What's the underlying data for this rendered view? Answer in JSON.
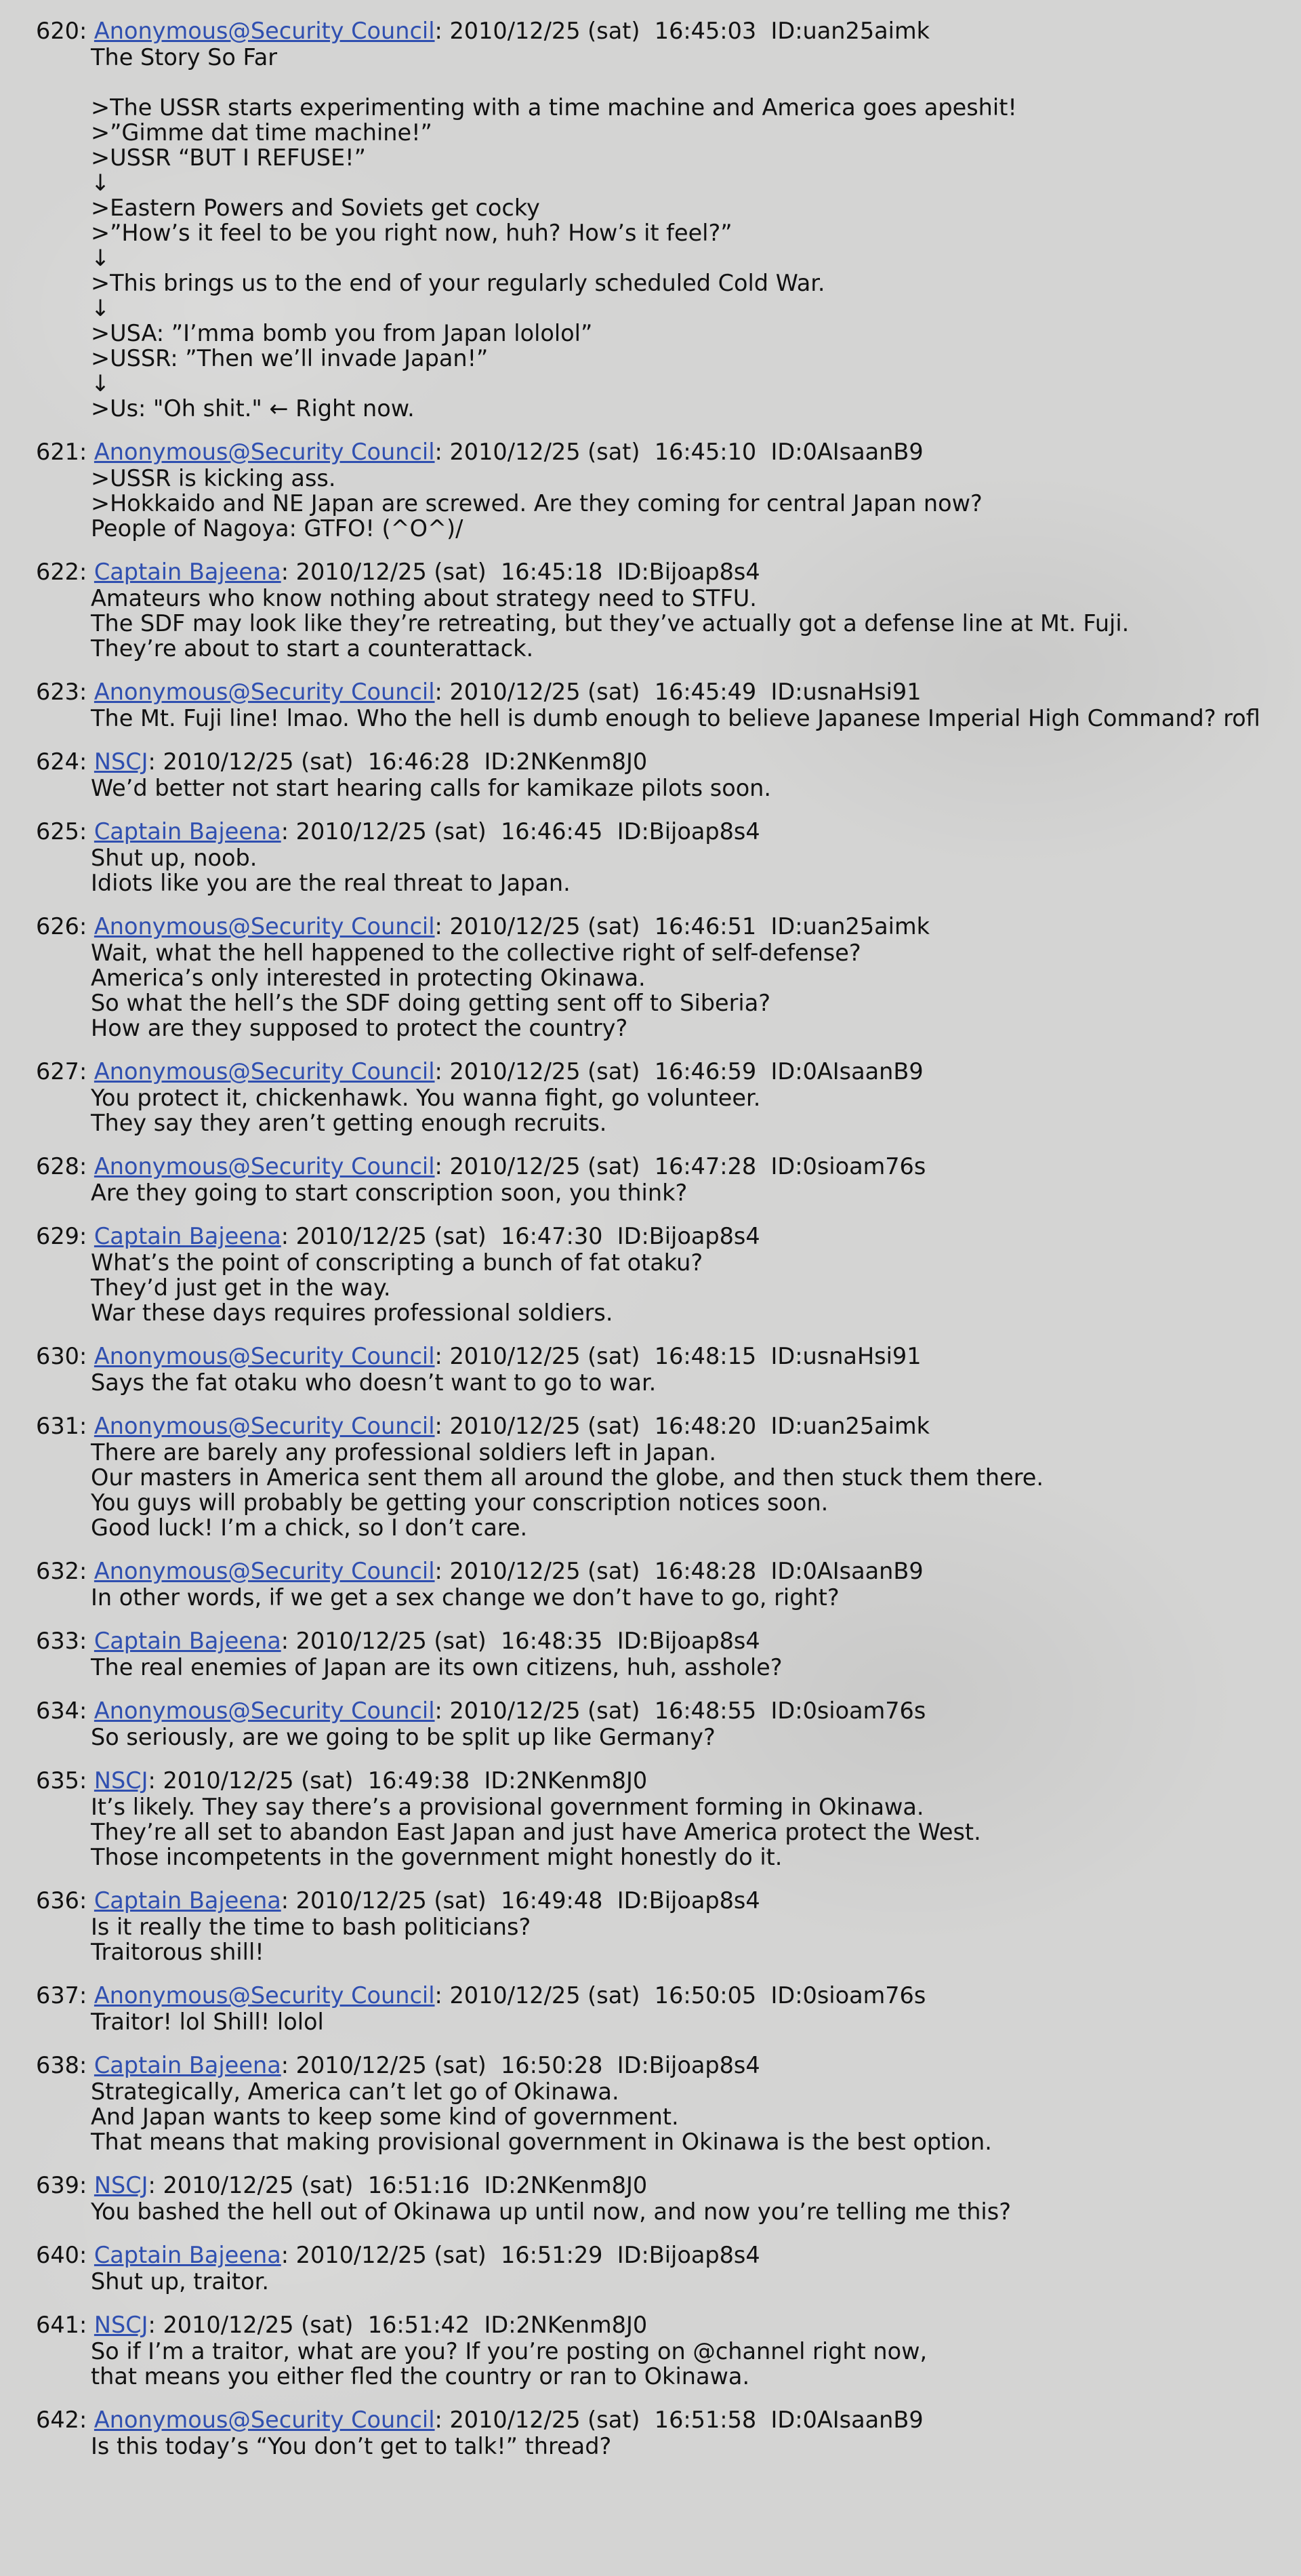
{
  "thread": {
    "posts": [
      {
        "number": "620",
        "name": "Anonymous@Security Council",
        "date": "2010/12/25 (sat)",
        "time": "16:45:03",
        "id": "ID:uan25aimk",
        "lines": [
          "The Story So Far",
          "",
          ">The USSR starts experimenting with a time machine and America goes apeshit!",
          ">”Gimme dat time machine!”",
          ">USSR “BUT I REFUSE!”",
          "↓",
          ">Eastern Powers and Soviets get cocky",
          ">”How’s it feel to be you right now, huh? How’s it feel?”",
          "↓",
          ">This brings us to the end of your regularly scheduled Cold War.",
          "↓",
          ">USA: ”I’mma bomb you from Japan lololol”",
          ">USSR: ”Then we’ll invade Japan!”",
          "↓",
          ">Us: \"Oh shit.\" ← Right now."
        ]
      },
      {
        "number": "621",
        "name": "Anonymous@Security Council",
        "date": "2010/12/25 (sat)",
        "time": "16:45:10",
        "id": "ID:0AIsaanB9",
        "lines": [
          ">USSR is kicking ass.",
          ">Hokkaido and NE Japan are screwed. Are they coming for central Japan now?",
          "People of Nagoya: GTFO! (^O^)/"
        ]
      },
      {
        "number": "622",
        "name": "Captain Bajeena",
        "date": "2010/12/25 (sat)",
        "time": "16:45:18",
        "id": "ID:Bijoap8s4",
        "lines": [
          "Amateurs who know nothing about strategy need to STFU.",
          "The SDF may look like they’re retreating, but they’ve actually got a defense line at Mt. Fuji.",
          "They’re about to start a counterattack."
        ]
      },
      {
        "number": "623",
        "name": "Anonymous@Security Council",
        "date": "2010/12/25 (sat)",
        "time": "16:45:49",
        "id": "ID:usnaHsi91",
        "lines": [
          "The Mt. Fuji line! lmao. Who the hell is dumb enough to believe Japanese Imperial High Command? rofl"
        ]
      },
      {
        "number": "624",
        "name": "NSCJ",
        "date": "2010/12/25 (sat)",
        "time": "16:46:28",
        "id": "ID:2NKenm8J0",
        "lines": [
          "We’d better not start hearing calls for kamikaze pilots soon."
        ]
      },
      {
        "number": "625",
        "name": "Captain Bajeena",
        "date": "2010/12/25 (sat)",
        "time": "16:46:45",
        "id": "ID:Bijoap8s4",
        "lines": [
          "Shut up, noob.",
          "Idiots like you are the real threat to Japan."
        ]
      },
      {
        "number": "626",
        "name": "Anonymous@Security Council",
        "date": "2010/12/25 (sat)",
        "time": "16:46:51",
        "id": "ID:uan25aimk",
        "lines": [
          "Wait, what the hell happened to the collective right of self-defense?",
          "America’s only interested in protecting Okinawa.",
          "So what the hell’s the SDF doing getting sent off to Siberia?",
          "How are they supposed to protect the country?"
        ]
      },
      {
        "number": "627",
        "name": "Anonymous@Security Council",
        "date": "2010/12/25 (sat)",
        "time": "16:46:59",
        "id": "ID:0AIsaanB9",
        "lines": [
          "You protect it, chickenhawk. You wanna fight, go volunteer.",
          "They say they aren’t getting enough recruits."
        ]
      },
      {
        "number": "628",
        "name": "Anonymous@Security Council",
        "date": "2010/12/25 (sat)",
        "time": "16:47:28",
        "id": "ID:0sioam76s",
        "lines": [
          "Are they going to start conscription soon, you think?"
        ]
      },
      {
        "number": "629",
        "name": "Captain Bajeena",
        "date": "2010/12/25 (sat)",
        "time": "16:47:30",
        "id": "ID:Bijoap8s4",
        "lines": [
          "What’s the point of conscripting a bunch of fat otaku?",
          "They’d just get in the way.",
          "War these days requires professional soldiers."
        ]
      },
      {
        "number": "630",
        "name": "Anonymous@Security Council",
        "date": "2010/12/25 (sat)",
        "time": "16:48:15",
        "id": "ID:usnaHsi91",
        "lines": [
          "Says the fat otaku who doesn’t want to go to war."
        ]
      },
      {
        "number": "631",
        "name": "Anonymous@Security Council",
        "date": "2010/12/25 (sat)",
        "time": "16:48:20",
        "id": "ID:uan25aimk",
        "lines": [
          "There are barely any professional soldiers left in Japan.",
          "Our masters in America sent them all around the globe, and then stuck them there.",
          "You guys will probably be getting your conscription notices soon.",
          "Good luck! I’m a chick, so I don’t care."
        ]
      },
      {
        "number": "632",
        "name": "Anonymous@Security Council",
        "date": "2010/12/25 (sat)",
        "time": "16:48:28",
        "id": "ID:0AIsaanB9",
        "lines": [
          "In other words, if we get a sex change we don’t have to go, right?"
        ]
      },
      {
        "number": "633",
        "name": "Captain Bajeena",
        "date": "2010/12/25 (sat)",
        "time": "16:48:35",
        "id": "ID:Bijoap8s4",
        "lines": [
          "The real enemies of Japan are its own citizens, huh, asshole?"
        ]
      },
      {
        "number": "634",
        "name": "Anonymous@Security Council",
        "date": "2010/12/25 (sat)",
        "time": "16:48:55",
        "id": "ID:0sioam76s",
        "lines": [
          "So seriously, are we going to be split up like Germany?"
        ]
      },
      {
        "number": "635",
        "name": "NSCJ",
        "date": "2010/12/25 (sat)",
        "time": "16:49:38",
        "id": "ID:2NKenm8J0",
        "lines": [
          "It’s likely. They say there’s a provisional government forming in Okinawa.",
          "They’re all set to abandon East Japan and just have America protect the West.",
          "Those incompetents in the government might honestly do it."
        ]
      },
      {
        "number": "636",
        "name": "Captain Bajeena",
        "date": "2010/12/25 (sat)",
        "time": "16:49:48",
        "id": "ID:Bijoap8s4",
        "lines": [
          "Is it really the time to bash politicians?",
          "Traitorous shill!"
        ]
      },
      {
        "number": "637",
        "name": "Anonymous@Security Council",
        "date": "2010/12/25 (sat)",
        "time": "16:50:05",
        "id": "ID:0sioam76s",
        "lines": [
          "Traitor! lol Shill! lolol"
        ]
      },
      {
        "number": "638",
        "name": "Captain Bajeena",
        "date": "2010/12/25 (sat)",
        "time": "16:50:28",
        "id": "ID:Bijoap8s4",
        "lines": [
          "Strategically, America can’t let go of Okinawa.",
          "And Japan wants to keep some kind of government.",
          "That means that making provisional government in Okinawa is the best option."
        ]
      },
      {
        "number": "639",
        "name": "NSCJ",
        "date": "2010/12/25 (sat)",
        "time": "16:51:16",
        "id": "ID:2NKenm8J0",
        "lines": [
          "You bashed the hell out of Okinawa up until now, and now you’re telling me this?"
        ]
      },
      {
        "number": "640",
        "name": "Captain Bajeena",
        "date": "2010/12/25 (sat)",
        "time": "16:51:29",
        "id": "ID:Bijoap8s4",
        "lines": [
          "Shut up, traitor."
        ]
      },
      {
        "number": "641",
        "name": "NSCJ",
        "date": "2010/12/25 (sat)",
        "time": "16:51:42",
        "id": "ID:2NKenm8J0",
        "lines": [
          "So if I’m a traitor, what are you? If you’re posting on @channel right now,",
          "that means you either fled the country or ran to Okinawa."
        ]
      },
      {
        "number": "642",
        "name": "Anonymous@Security Council",
        "date": "2010/12/25 (sat)",
        "time": "16:51:58",
        "id": "ID:0AIsaanB9",
        "lines": [
          "Is this today’s “You don’t get to talk!” thread?"
        ]
      }
    ]
  }
}
